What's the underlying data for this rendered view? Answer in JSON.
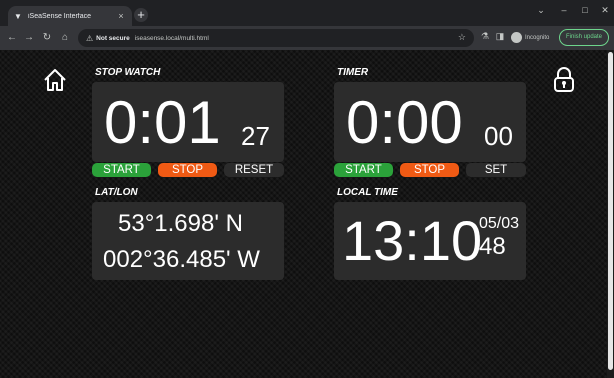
{
  "browser": {
    "tab_title": "iSeaSense Interface",
    "tab_close": "×",
    "new_tab": "+",
    "security_label": "Not secure",
    "url": "iseasense.local/multi.html",
    "incognito_label": "Incognito",
    "update_label": "Finish update"
  },
  "stopwatch": {
    "label": "STOP WATCH",
    "main": "0:01",
    "fraction": "27",
    "start_label": "START",
    "stop_label": "STOP",
    "reset_label": "RESET"
  },
  "timer": {
    "label": "TIMER",
    "main": "0:00",
    "fraction": "00",
    "start_label": "START",
    "stop_label": "STOP",
    "set_label": "SET"
  },
  "latlon": {
    "label": "LAT/LON",
    "lat": "53°1.698' N",
    "lon": "002°36.485' W"
  },
  "local_time": {
    "label": "LOCAL TIME",
    "hhmm": "13:10",
    "date": "05/03",
    "seconds": "48"
  },
  "colors": {
    "start": "#2ba23a",
    "stop": "#f05a14",
    "panel": "#2c2c2c"
  },
  "icons": {
    "home": "home-icon",
    "lock": "lock-icon"
  }
}
